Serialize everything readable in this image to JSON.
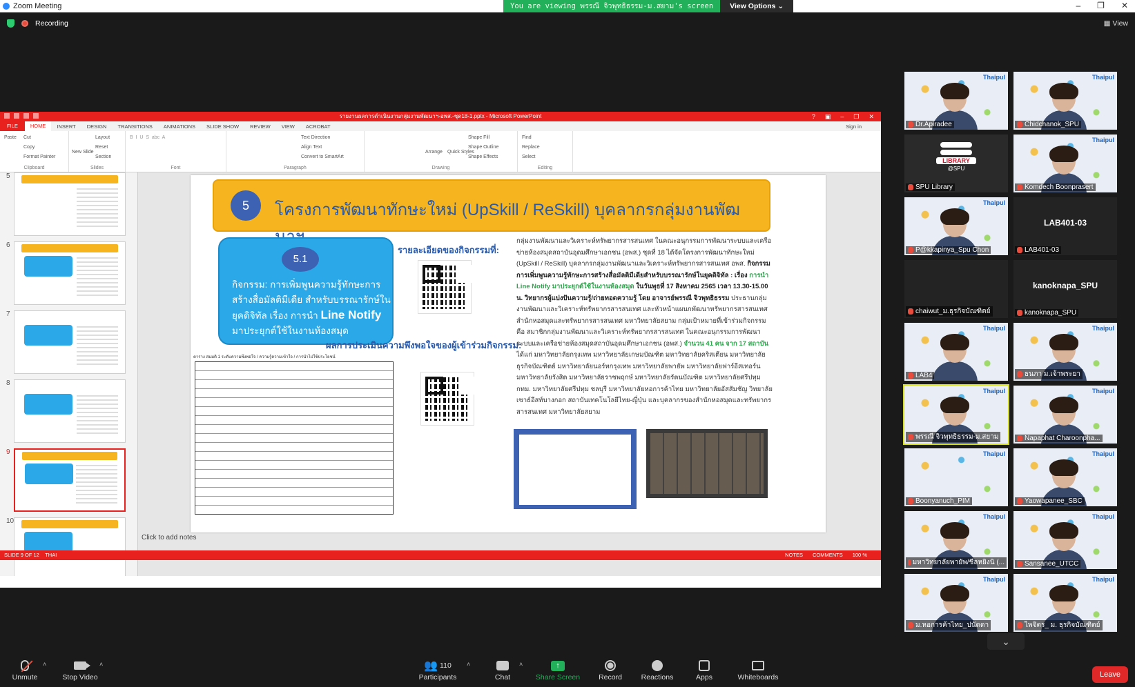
{
  "window": {
    "title": "Zoom Meeting"
  },
  "banner": {
    "message": "You are viewing พรรณี จิวพุทธิธรรม-ม.สยาม's screen",
    "options": "View Options ⌄"
  },
  "recording": {
    "label": "Recording"
  },
  "view_button": {
    "label": "View"
  },
  "ppt": {
    "title": "รายงานผลการดำเนินงานกลุ่มงานพัฒนาฯ-อพส.-ชุด18-1.pptx - Microsoft PowerPoint",
    "tabs": [
      "FILE",
      "HOME",
      "INSERT",
      "DESIGN",
      "TRANSITIONS",
      "ANIMATIONS",
      "SLIDE SHOW",
      "REVIEW",
      "VIEW",
      "ACROBAT"
    ],
    "sign_in": "Sign in",
    "groups": {
      "clipboard": {
        "name": "Clipboard",
        "items": [
          "Paste",
          "Cut",
          "Copy",
          "Format Painter"
        ]
      },
      "slides": {
        "name": "Slides",
        "items": [
          "New Slide",
          "Layout",
          "Reset",
          "Section"
        ]
      },
      "font": {
        "name": "Font"
      },
      "paragraph": {
        "name": "Paragraph",
        "items": [
          "Text Direction",
          "Align Text",
          "Convert to SmartArt"
        ]
      },
      "drawing": {
        "name": "Drawing",
        "items": [
          "Arrange",
          "Quick Styles",
          "Shape Fill",
          "Shape Outline",
          "Shape Effects"
        ]
      },
      "editing": {
        "name": "Editing",
        "items": [
          "Find",
          "Replace",
          "Select"
        ]
      }
    },
    "thumb_numbers": [
      "5",
      "6",
      "7",
      "8",
      "9",
      "10"
    ],
    "slide": {
      "number": "5",
      "title": "โครงการพัฒนาทักษะใหม่ (UpSkill / ReSkill) บุคลากรกลุ่มงานพัฒนาฯ",
      "sub_number": "5.1",
      "activity_text": "กิจกรรม: การเพิ่มพูนความรู้ทักษะการสร้างสื่อมัลติมีเดีย สำหรับบรรณารักษ์ในยุคดิจิทัล เรื่อง การนำ",
      "activity_bold": "Line Notify",
      "activity_tail": "มาประยุกต์ใช้ในงานห้องสมุด",
      "details_label": "รายละเอียดของกิจกรรมที่:",
      "eval_label": "ผลการประเมินความพึงพอใจของผู้เข้าร่วมกิจกรรม:",
      "table_caption": "ตาราง สมมติ 1 ระดับความพึงพอใจ / ความรู้ความเข้าใจ / การนำไปใช้ประโยชน์",
      "paragraph_1": "กลุ่มงานพัฒนาและวิเคราะห์ทรัพยากรสารสนเทศ ในคณะอนุกรรมการพัฒนาระบบและเครือข่ายห้องสมุดสถาบันอุดมศึกษาเอกชน (อพส.) ชุดที่ 18 ได้จัดโครงการพัฒนาทักษะใหม่ (UpSkill / ReSkill) บุคลากรกลุ่มงานพัฒนาและวิเคราะห์ทรัพยากรสารสนเทศ อพส.",
      "paragraph_bold": "กิจกรรมการเพิ่มพูนความรู้ทักษะการสร้างสื่อมัลติมีเดียสำหรับบรรณารักษ์ในยุคดิจิทัล : เรื่อง",
      "paragraph_green": "การนำ Line Notify มาประยุกต์ใช้ในงานห้องสมุด",
      "paragraph_date": "ในวันพุธที่ 17 สิงหาคม 2565 เวลา 13.30-15.00 น. วิทยากรผู้แบ่งปันความรู้/ถ่ายทอดความรู้ โดย อาจารย์พรรณี จิวพุทธิธรรม",
      "paragraph_2": "ประธานกลุ่มงานพัฒนาและวิเคราะห์ทรัพยากรสารสนเทศ และหัวหน้าแผนกพัฒนาทรัพยากรสารสนเทศ สำนักหอสมุดและทรัพยากรสารสนเทศ มหาวิทยาลัยสยาม กลุ่มเป้าหมายที่เข้าร่วมกิจกรรม คือ สมาชิกกลุ่มงานพัฒนาและวิเคราะห์ทรัพยากรสารสนเทศ ในคณะอนุกรรมการพัฒนาระบบและเครือข่ายห้องสมุดสถาบันอุดมศึกษาเอกชน (อพส.)",
      "paragraph_count": "จำนวน 41 คน จาก 17 สถาบัน",
      "paragraph_3": "ได้แก่ มหาวิทยาลัยกรุงเทพ มหาวิทยาลัยเกษมบัณฑิต มหาวิทยาลัยคริสเตียน มหาวิทยาลัยธุรกิจบัณฑิตย์ มหาวิทยาลัยนอร์ทกรุงเทพ มหาวิทยาลัยพายัพ มหาวิทยาลัยฟาร์อีสเทอร์น มหาวิทยาลัยรังสิต มหาวิทยาลัยราชพฤกษ์ มหาวิทยาลัยรัตนบัณฑิต มหาวิทยาลัยศรีปทุม กทม. มหาวิทยาลัยศรีปทุม ชลบุรี มหาวิทยาลัยหอการค้าไทย มหาวิทยาลัยอัสสัมชัญ วิทยาลัยเซาธ์อีสท์บางกอก สถาบันเทคโนโลยีไทย-ญี่ปุ่น และบุคลากรของสำนักหอสมุดและทรัพยากรสารสนเทศ มหาวิทยาลัยสยาม"
    },
    "notes": "Click to add notes",
    "status": {
      "slide": "SLIDE 9 OF 12",
      "lang": "THAI",
      "notes": "NOTES",
      "comments": "COMMENTS",
      "zoom": "100 %"
    }
  },
  "gallery": [
    {
      "name": "Dr.Apiradee",
      "type": "video"
    },
    {
      "name": "Chidchanok_SPU",
      "type": "video"
    },
    {
      "name": "SPU Library",
      "type": "logo"
    },
    {
      "name": "Komdech Boonprasert",
      "type": "video"
    },
    {
      "name": "P@kkapinya_Spu Chon",
      "type": "video"
    },
    {
      "name": "LAB401-03",
      "type": "text",
      "big": "LAB401-03"
    },
    {
      "name": "chaiwut_ม.ธุรกิจบัณฑิตย์",
      "type": "black"
    },
    {
      "name": "kanoknapa_SPU",
      "type": "text",
      "big": "kanoknapa_SPU"
    },
    {
      "name": "LAB4",
      "type": "video"
    },
    {
      "name": "ธนภา ม.เจ้าพระยา",
      "type": "video"
    },
    {
      "name": "พรรณี จิวพุทธิธรรม-ม.สยาม",
      "type": "video",
      "active": true
    },
    {
      "name": "Napaphat Charoonpha...",
      "type": "video"
    },
    {
      "name": "Boonyanuch_PIM",
      "type": "bg"
    },
    {
      "name": "Yaowapanee_SBC",
      "type": "video"
    },
    {
      "name": "มหาวิทยาลัยพายัพ/ชีลหยิงนิ (...",
      "type": "video"
    },
    {
      "name": "Sansanee_UTCC",
      "type": "video"
    },
    {
      "name": "ม.หอการค้าไทย_ปนัดดา",
      "type": "video"
    },
    {
      "name": "ไพจิตร_ ม. ธุรกิจบัณฑิตย์",
      "type": "video"
    }
  ],
  "library_logo": {
    "word": "LIBRARY",
    "sub": "@SPU"
  },
  "toolbar": {
    "unmute": "Unmute",
    "stop_video": "Stop Video",
    "participants": "Participants",
    "participants_count": "110",
    "chat": "Chat",
    "share_screen": "Share Screen",
    "record": "Record",
    "reactions": "Reactions",
    "apps": "Apps",
    "whiteboards": "Whiteboards",
    "leave": "Leave"
  }
}
